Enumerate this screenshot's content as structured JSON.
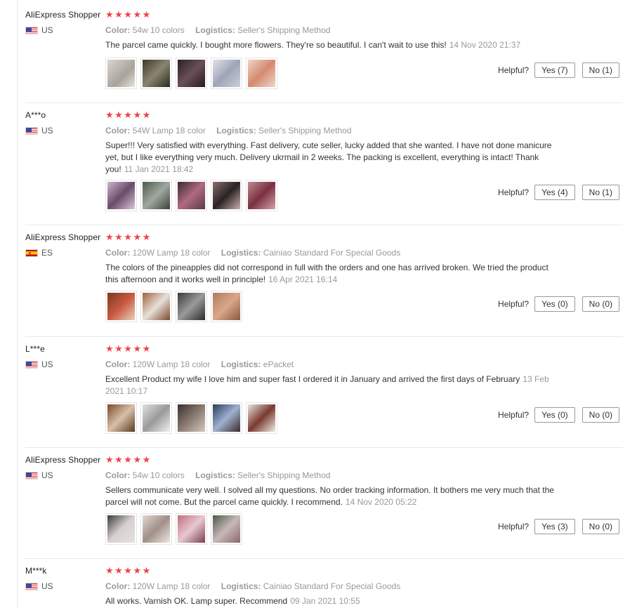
{
  "colors": {
    "star": "#f0424b",
    "muted": "#999999",
    "text": "#333333",
    "border": "#999999"
  },
  "labels": {
    "helpful": "Helpful?",
    "color_label": "Color:",
    "logistics_label": "Logistics:"
  },
  "reviews": [
    {
      "user": "AliExpress Shopper",
      "country": "US",
      "flag": "us",
      "stars": "★★★★★",
      "rating": 5,
      "color": "54w 10 colors",
      "logistics": "Seller's Shipping Method",
      "text": "The parcel came quickly. I bought more flowers. They're so beautiful. I can't wait to use this!",
      "date": "14 Nov 2020 21:37",
      "yes": "Yes (7)",
      "no": "No (1)",
      "thumbs": [
        "linear-gradient(135deg,#d8d4cf,#a9a39a 60%,#e8e4de)",
        "linear-gradient(135deg,#3c3a2c,#8a8570 50%,#2a2a22)",
        "linear-gradient(135deg,#2b1f24,#6a5058 50%,#221a1c)",
        "linear-gradient(135deg,#e4e2e8,#9fa5b8 50%,#c9cfd8)",
        "linear-gradient(135deg,#f0d6c8,#d48a70 50%,#eed8cc)"
      ]
    },
    {
      "user": "A***o",
      "country": "US",
      "flag": "us",
      "stars": "★★★★★",
      "rating": 5,
      "color": "54W Lamp 18 color",
      "logistics": "Seller's Shipping Method",
      "text": "Super!!! Very satisfied with everything. Fast delivery, cute seller, lucky added that she wanted. I have not done manicure yet, but I like everything very much. Delivery ukrmail in 2 weeks. The packing is excellent, everything is intact! Thank you!",
      "date": "11 Jan 2021 18:42",
      "yes": "Yes (4)",
      "no": "No (1)",
      "thumbs": [
        "linear-gradient(135deg,#c8b8c8,#6a4a6a 50%,#d8c8d8)",
        "linear-gradient(135deg,#4a5a4a,#a0a8a0 50%,#3a423a)",
        "linear-gradient(135deg,#3a2a30,#b06a80 50%,#5a3a44)",
        "linear-gradient(135deg,#8a7070,#2a2222 50%,#c8b0b0)",
        "linear-gradient(135deg,#c08a90,#7a3040 50%,#d8a0a8)"
      ]
    },
    {
      "user": "AliExpress Shopper",
      "country": "ES",
      "flag": "es",
      "stars": "★★★★★",
      "rating": 5,
      "color": "120W Lamp 18 color",
      "logistics": "Cainiao Standard For Special Goods",
      "text": "The colors of the pineapples did not correspond in full with the orders and one has arrived broken. We tried the product this afternoon and it works well in principle!",
      "date": "16 Apr 2021 16:14",
      "yes": "Yes (0)",
      "no": "No (0)",
      "thumbs": [
        "linear-gradient(135deg,#7a3a20,#c85a40 50%,#e8d0c0)",
        "linear-gradient(135deg,#a06040,#e8e0d8 50%,#7a4a30)",
        "linear-gradient(135deg,#3a3a3a,#9a9a9a 50%,#2a2a2a)",
        "linear-gradient(135deg,#b07a60,#d8a888 50%,#8a5a40)"
      ]
    },
    {
      "user": "L***e",
      "country": "US",
      "flag": "us",
      "stars": "★★★★★",
      "rating": 5,
      "color": "120W Lamp 18 color",
      "logistics": "ePacket",
      "text": "Excellent Product my wife I love him and super fast I ordered it in January and arrived the first days of February",
      "date": "13 Feb 2021 10:17",
      "yes": "Yes (0)",
      "no": "No (0)",
      "thumbs": [
        "linear-gradient(135deg,#7a4a2a,#d8c0a8 50%,#5a3a20)",
        "linear-gradient(135deg,#e0e0e0,#9a9a9a 50%,#f0f0f0)",
        "linear-gradient(135deg,#3a3030,#8a7a70 50%,#d0c8c0)",
        "linear-gradient(135deg,#2a3a5a,#a0b0d0 50%,#3a2a2a)",
        "linear-gradient(135deg,#e8e4e0,#7a3a30 50%,#f0ece8)"
      ]
    },
    {
      "user": "AliExpress Shopper",
      "country": "US",
      "flag": "us",
      "stars": "★★★★★",
      "rating": 5,
      "color": "54w 10 colors",
      "logistics": "Seller's Shipping Method",
      "text": "Sellers communicate very well. I solved all my questions. No order tracking information. It bothers me very much that the parcel will not come. But the parcel came quickly. I recommend.",
      "date": "14 Nov 2020 05:22",
      "yes": "Yes (3)",
      "no": "No (0)",
      "thumbs": [
        "linear-gradient(135deg,#3a3a3a,#d8d0d0 50%,#e8e0e0)",
        "linear-gradient(135deg,#e0d8d0,#a09088 50%,#f0e8e0)",
        "linear-gradient(135deg,#c07080,#e8c8d0 50%,#7a4050)",
        "linear-gradient(135deg,#4a5a4a,#c8b8b8 50%,#8a6a6a)"
      ]
    },
    {
      "user": "M***k",
      "country": "US",
      "flag": "us",
      "stars": "★★★★★",
      "rating": 5,
      "color": "120W Lamp 18 color",
      "logistics": "Cainiao Standard For Special Goods",
      "text": "All works. Varnish OK. Lamp super. Recommend",
      "date": "09 Jan 2021 10:55",
      "yes": "",
      "no": "",
      "thumbs": []
    }
  ]
}
